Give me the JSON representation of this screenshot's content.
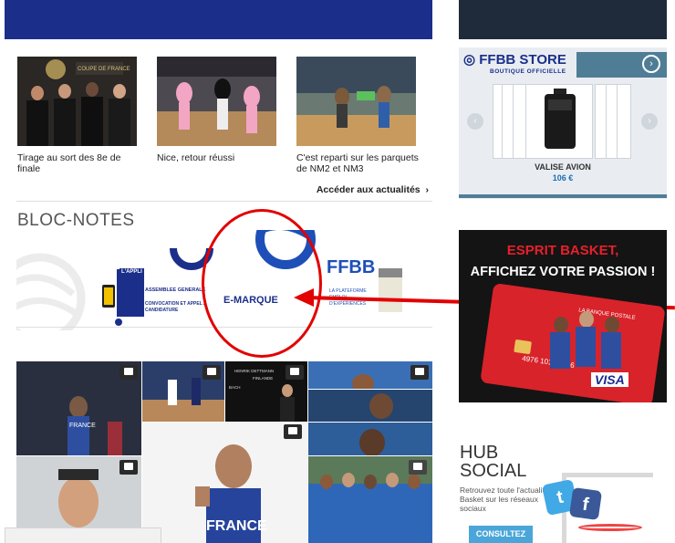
{
  "news": [
    {
      "caption": "Tirage au sort des 8e de finale",
      "thumb_overlay": "COUPE DE FRANCE"
    },
    {
      "caption": "Nice, retour réussi"
    },
    {
      "caption": "C'est reparti sur les parquets de NM2 et NM3"
    }
  ],
  "news_more": "Accéder aux actualités",
  "news_more_icon": "chevron-right-icon",
  "bloc_notes": {
    "title": "BLOC-NOTES",
    "slides": {
      "appli": "L'APPLI",
      "assemblee": "ASSEMBLEE GENERALE",
      "convocation": "CONVOCATION ET APPEL A CANDIDATURE",
      "emarque": "E-MARQUE",
      "ffbb": "FFBB",
      "plateforme": "LA PLATEFORME EMPLOI D'EXPERIENCES"
    }
  },
  "video_grid_tags": {
    "tile3_line1": "HENRIK DETTMANN",
    "tile3_line2": "FINLANDE",
    "tile3_line3": "BACH",
    "tile_big_jersey": "FRANCE",
    "tile1_jersey": "FRANCE"
  },
  "store": {
    "logo": "FFBB STORE",
    "subtitle": "BOUTIQUE OFFICIELLE",
    "next_icon": "chevron-right-circle-icon",
    "prev_arrow": "‹",
    "next_arrow": "›",
    "product_name": "VALISE AVION",
    "product_price": "106 €"
  },
  "ad": {
    "line1": "ESPRIT BASKET,",
    "line2": "AFFICHEZ VOTRE PASSION !",
    "card_brand": "VISA",
    "card_number": "4976 1012 3456",
    "card_top": "LA BANQUE POSTALE"
  },
  "hub": {
    "title_line1": "HUB",
    "title_line2": "SOCIAL",
    "desc": "Retrouvez toute l'actualité Basket sur les réseaux sociaux",
    "button": "CONSULTEZ",
    "twitter": "t",
    "facebook": "f"
  },
  "colors": {
    "ffbb_blue": "#1b2f8a",
    "store_teal": "#4f7d96",
    "annotation_red": "#e20000",
    "hub_button": "#4aa6d8"
  }
}
